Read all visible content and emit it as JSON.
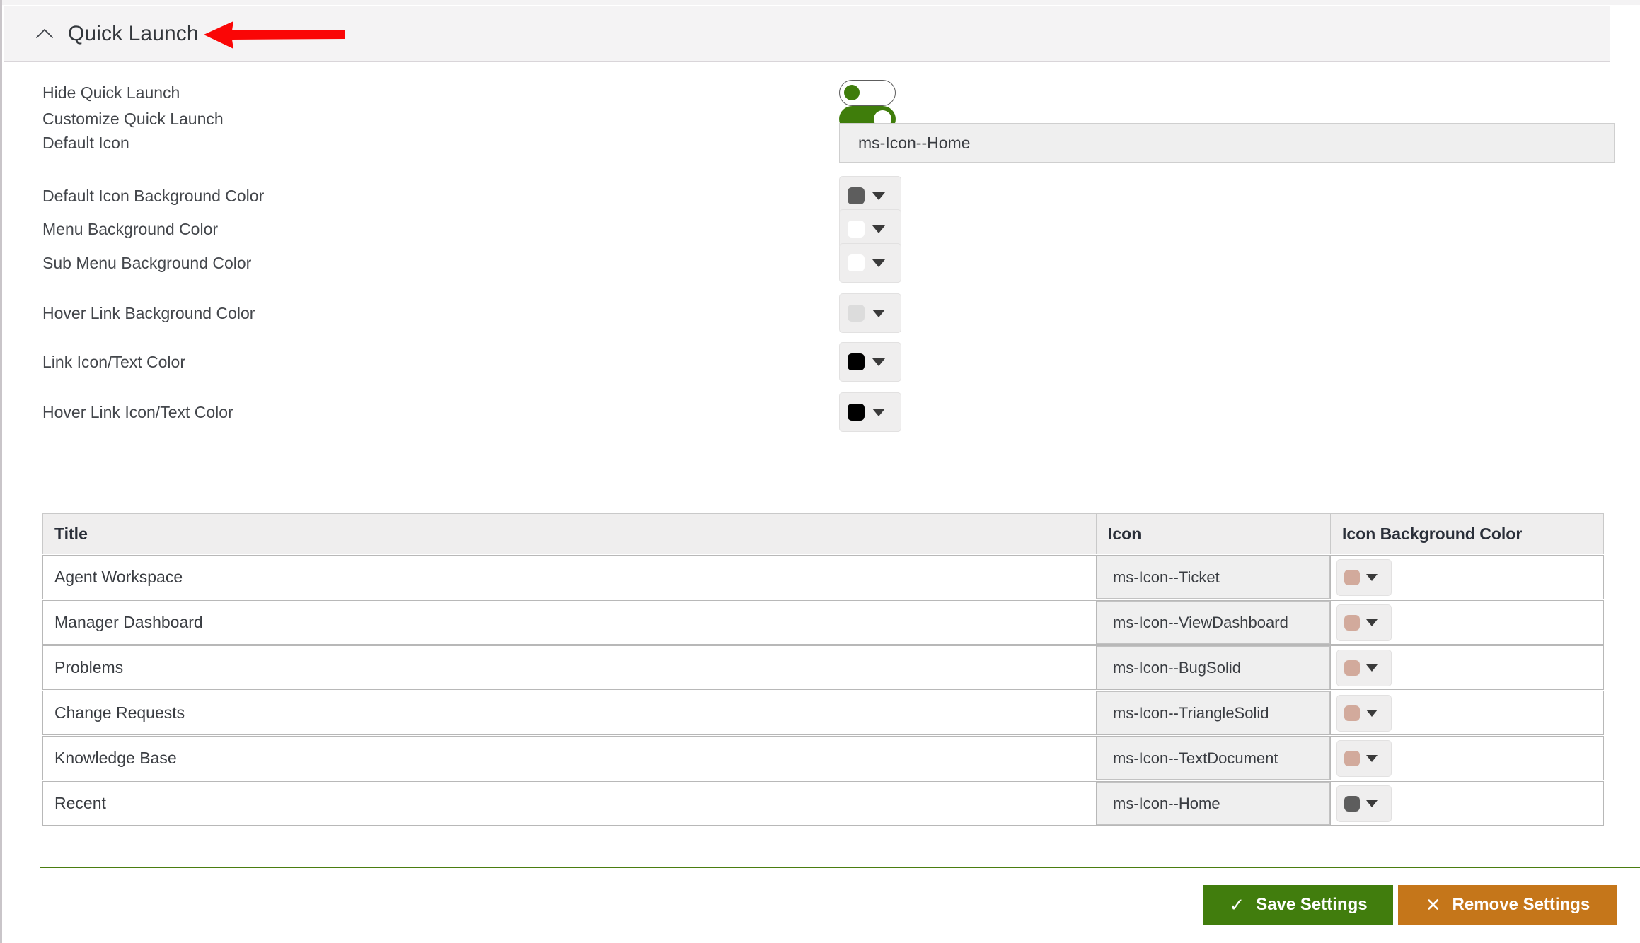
{
  "panel": {
    "title": "Quick Launch",
    "collapse_icon": "chevron-up-icon",
    "annotation": "red-left-arrow"
  },
  "form": {
    "rows": [
      {
        "label": "Hide Quick Launch",
        "control": "toggle",
        "value": "off"
      },
      {
        "label": "Customize Quick Launch",
        "control": "toggle",
        "value": "on"
      },
      {
        "label": "Default Icon",
        "control": "text",
        "value": "ms-Icon--Home"
      },
      {
        "label": "Default Icon Background Color",
        "control": "color",
        "value": "#5d5d5d"
      },
      {
        "label": "Menu Background Color",
        "control": "color",
        "value": "#ffffff"
      },
      {
        "label": "Sub Menu Background Color",
        "control": "color",
        "value": "#ffffff"
      },
      {
        "label": "Hover Link Background Color",
        "control": "color",
        "value": "#dcdcdc"
      },
      {
        "label": "Link Icon/Text Color",
        "control": "color",
        "value": "#000000"
      },
      {
        "label": "Hover Link Icon/Text Color",
        "control": "color",
        "value": "#000000"
      }
    ]
  },
  "table": {
    "columns": [
      "Title",
      "Icon",
      "Icon Background Color"
    ],
    "rows": [
      {
        "title": "Agent Workspace",
        "icon": "ms-Icon--Ticket",
        "icon_bg": "#d2aa9c"
      },
      {
        "title": "Manager Dashboard",
        "icon": "ms-Icon--ViewDashboard",
        "icon_bg": "#d2aa9c"
      },
      {
        "title": "Problems",
        "icon": "ms-Icon--BugSolid",
        "icon_bg": "#d2aa9c"
      },
      {
        "title": "Change Requests",
        "icon": "ms-Icon--TriangleSolid",
        "icon_bg": "#d2aa9c"
      },
      {
        "title": "Knowledge Base",
        "icon": "ms-Icon--TextDocument",
        "icon_bg": "#d2aa9c"
      },
      {
        "title": "Recent",
        "icon": "ms-Icon--Home",
        "icon_bg": "#5d5d5d"
      }
    ]
  },
  "footer": {
    "save_label": "Save Settings",
    "save_icon": "check-icon",
    "save_glyph": "✓",
    "save_color": "#417d0d",
    "remove_label": "Remove Settings",
    "remove_icon": "close-icon",
    "remove_glyph": "✕",
    "remove_color": "#c5761a",
    "divider_color": "#4a7d10"
  }
}
